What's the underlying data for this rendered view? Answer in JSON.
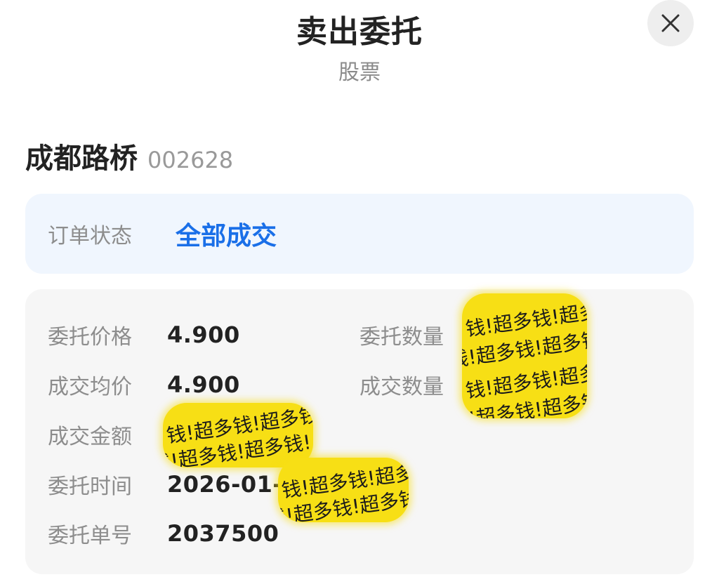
{
  "header": {
    "title": "卖出委托",
    "subtitle": "股票"
  },
  "stock": {
    "name": "成都路桥",
    "code": "002628"
  },
  "order_status": {
    "label": "订单状态",
    "value": "全部成交"
  },
  "details": {
    "entrust_price": {
      "label": "委托价格",
      "value": "4.900"
    },
    "entrust_qty": {
      "label": "委托数量",
      "value": ""
    },
    "avg_price": {
      "label": "成交均价",
      "value": "4.900"
    },
    "deal_qty": {
      "label": "成交数量",
      "value": ""
    },
    "deal_amount": {
      "label": "成交金额",
      "value": ""
    },
    "entrust_time": {
      "label": "委托时间",
      "value": "2026-01-"
    },
    "order_no": {
      "label": "委托单号",
      "value": "2037500"
    }
  },
  "sticker_text": "钱!超多钱!超多钱!",
  "colors": {
    "accent_blue": "#1a6fe8",
    "status_bg": "#f0f6fe",
    "detail_bg": "#f6f6f6",
    "sticker_yellow": "#f7df15"
  },
  "icons": {
    "close": "close-icon"
  }
}
